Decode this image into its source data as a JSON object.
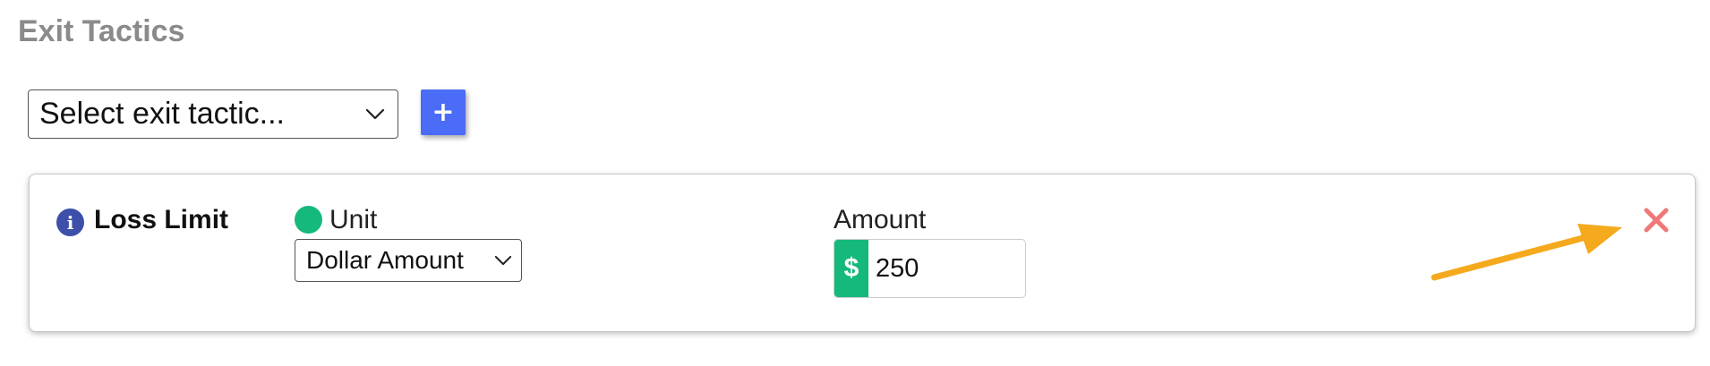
{
  "section": {
    "title": "Exit Tactics"
  },
  "tactic_picker": {
    "selected_label": "Select exit tactic...",
    "add_button_label": "+"
  },
  "tactic_card": {
    "name": "Loss Limit",
    "info_icon_glyph": "i",
    "unit": {
      "label": "Unit",
      "selected": "Dollar Amount",
      "status_color": "#16b97c"
    },
    "amount": {
      "label": "Amount",
      "currency_symbol": "$",
      "value": "250"
    },
    "remove_icon": "close-icon",
    "remove_color": "#f07878"
  },
  "annotation": {
    "arrow_color": "#f5a91c"
  },
  "colors": {
    "title_gray": "#8a8a8a",
    "add_button_blue": "#4a6cf7",
    "info_blue": "#3d4fa8",
    "accent_green": "#16b97c"
  }
}
